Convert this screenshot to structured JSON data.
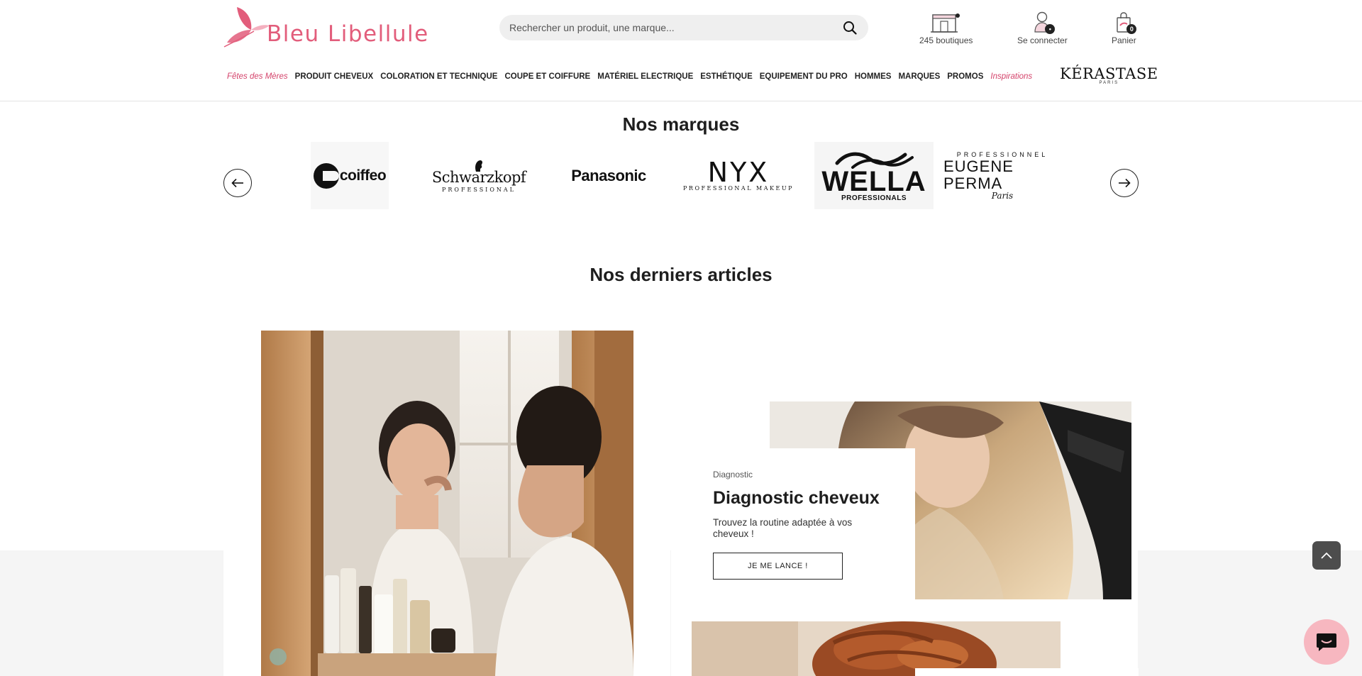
{
  "header": {
    "logo_text": "Bleu Libellule",
    "search_placeholder": "Rechercher un produit, une marque...",
    "stores_label": "245 boutiques",
    "login_label": "Se connecter",
    "cart_label": "Panier",
    "cart_count": "0",
    "account_badge": "•"
  },
  "nav": {
    "items": [
      {
        "label": "Fêtes des Mères",
        "special": true
      },
      {
        "label": "PRODUIT CHEVEUX"
      },
      {
        "label": "COLORATION ET TECHNIQUE"
      },
      {
        "label": "COUPE ET COIFFURE"
      },
      {
        "label": "MATÉRIEL ELECTRIQUE"
      },
      {
        "label": "ESTHÉTIQUE"
      },
      {
        "label": "EQUIPEMENT DU PRO"
      },
      {
        "label": "HOMMES"
      },
      {
        "label": "MARQUES"
      },
      {
        "label": "PROMOS"
      },
      {
        "label": "Inspirations",
        "special": true
      }
    ],
    "kerastase_name": "KÉRASTASE",
    "kerastase_sub": "PARIS"
  },
  "brands": {
    "title": "Nos marques",
    "items": {
      "coiffeo": "coiffeo",
      "schwarzkopf": "Schwarzkopf",
      "schwarzkopf_sub": "PROFESSIONAL",
      "panasonic": "Panasonic",
      "nyx": "NYX",
      "nyx_sub": "PROFESSIONAL MAKEUP",
      "wella": "WELLA",
      "wella_sub": "PROFESSIONALS",
      "eugene_top": "PROFESSIONNEL",
      "eugene": "EUGENE PERMA",
      "eugene_paris": "Paris"
    }
  },
  "articles": {
    "title": "Nos derniers articles",
    "diagnostic": {
      "category": "Diagnostic",
      "title": "Diagnostic cheveux",
      "description": "Trouvez la routine adaptée à vos cheveux !",
      "button": "JE ME LANCE !"
    }
  },
  "colors": {
    "brand_pink": "#e25d7b",
    "nav_special": "#d4426a",
    "chat_pink": "#f7b7c0",
    "scroll_top_bg": "#4d4d4d"
  },
  "icons": [
    "search-icon",
    "store-icon",
    "user-icon",
    "bag-icon",
    "arrow-left-icon",
    "arrow-right-icon",
    "chevron-up-icon",
    "chat-icon"
  ]
}
